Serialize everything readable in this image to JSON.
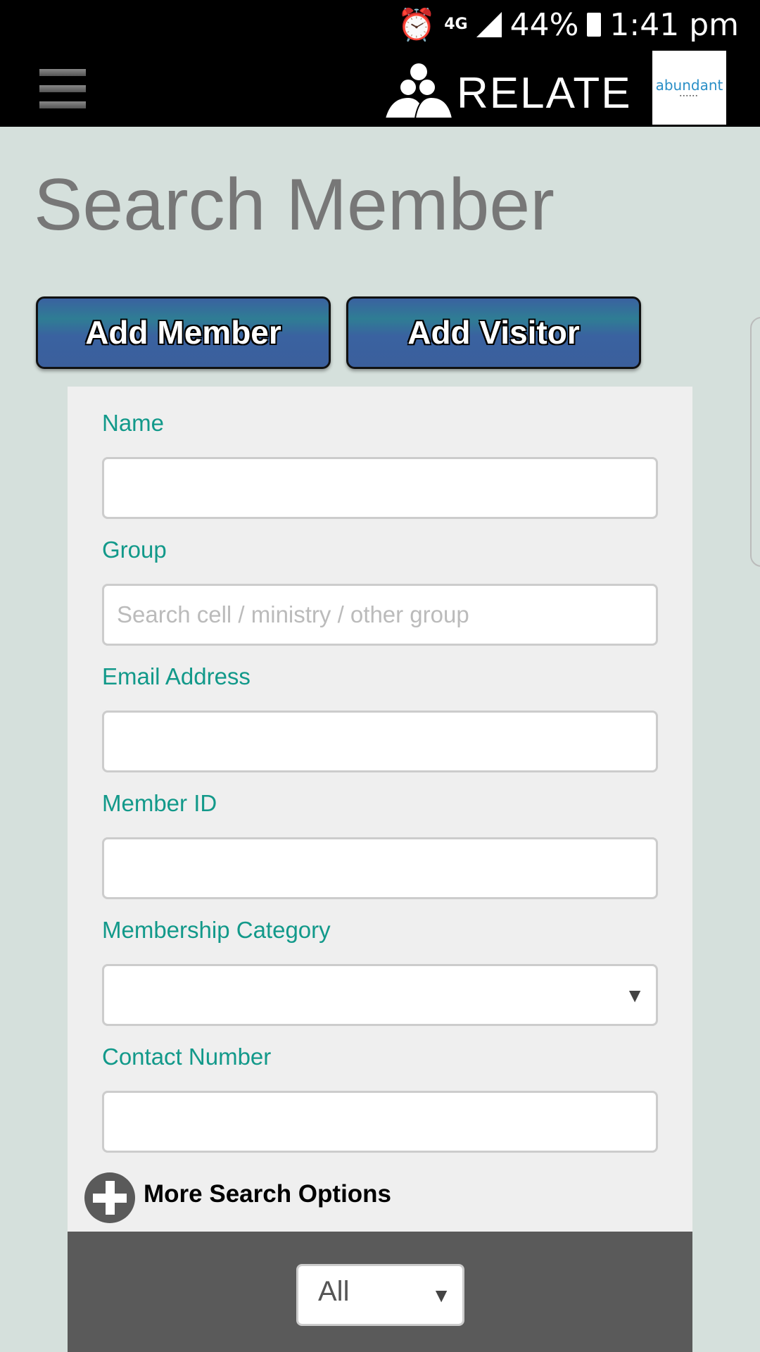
{
  "status_bar": {
    "battery": "44%",
    "time": "1:41 pm",
    "network": "4G",
    "icons": [
      "alarm-icon",
      "signal-icon",
      "battery-charging-icon"
    ]
  },
  "header": {
    "logo_text": "RELATE",
    "brand_text": "abundant",
    "menu_icon": "hamburger-icon"
  },
  "page": {
    "title": "Search Member"
  },
  "buttons": {
    "add_member": "Add Member",
    "add_visitor": "Add Visitor"
  },
  "form": {
    "name": {
      "label": "Name",
      "value": ""
    },
    "group": {
      "label": "Group",
      "placeholder": "Search cell / ministry / other group",
      "value": ""
    },
    "email": {
      "label": "Email Address",
      "value": ""
    },
    "member_id": {
      "label": "Member ID",
      "value": ""
    },
    "membership_category": {
      "label": "Membership Category",
      "value": ""
    },
    "contact": {
      "label": "Contact Number",
      "value": ""
    },
    "more_options": "More Search Options"
  },
  "filter": {
    "selected": "All"
  },
  "colors": {
    "label": "#12998a",
    "button": "#3a62a0",
    "background": "#d5e0dc"
  }
}
